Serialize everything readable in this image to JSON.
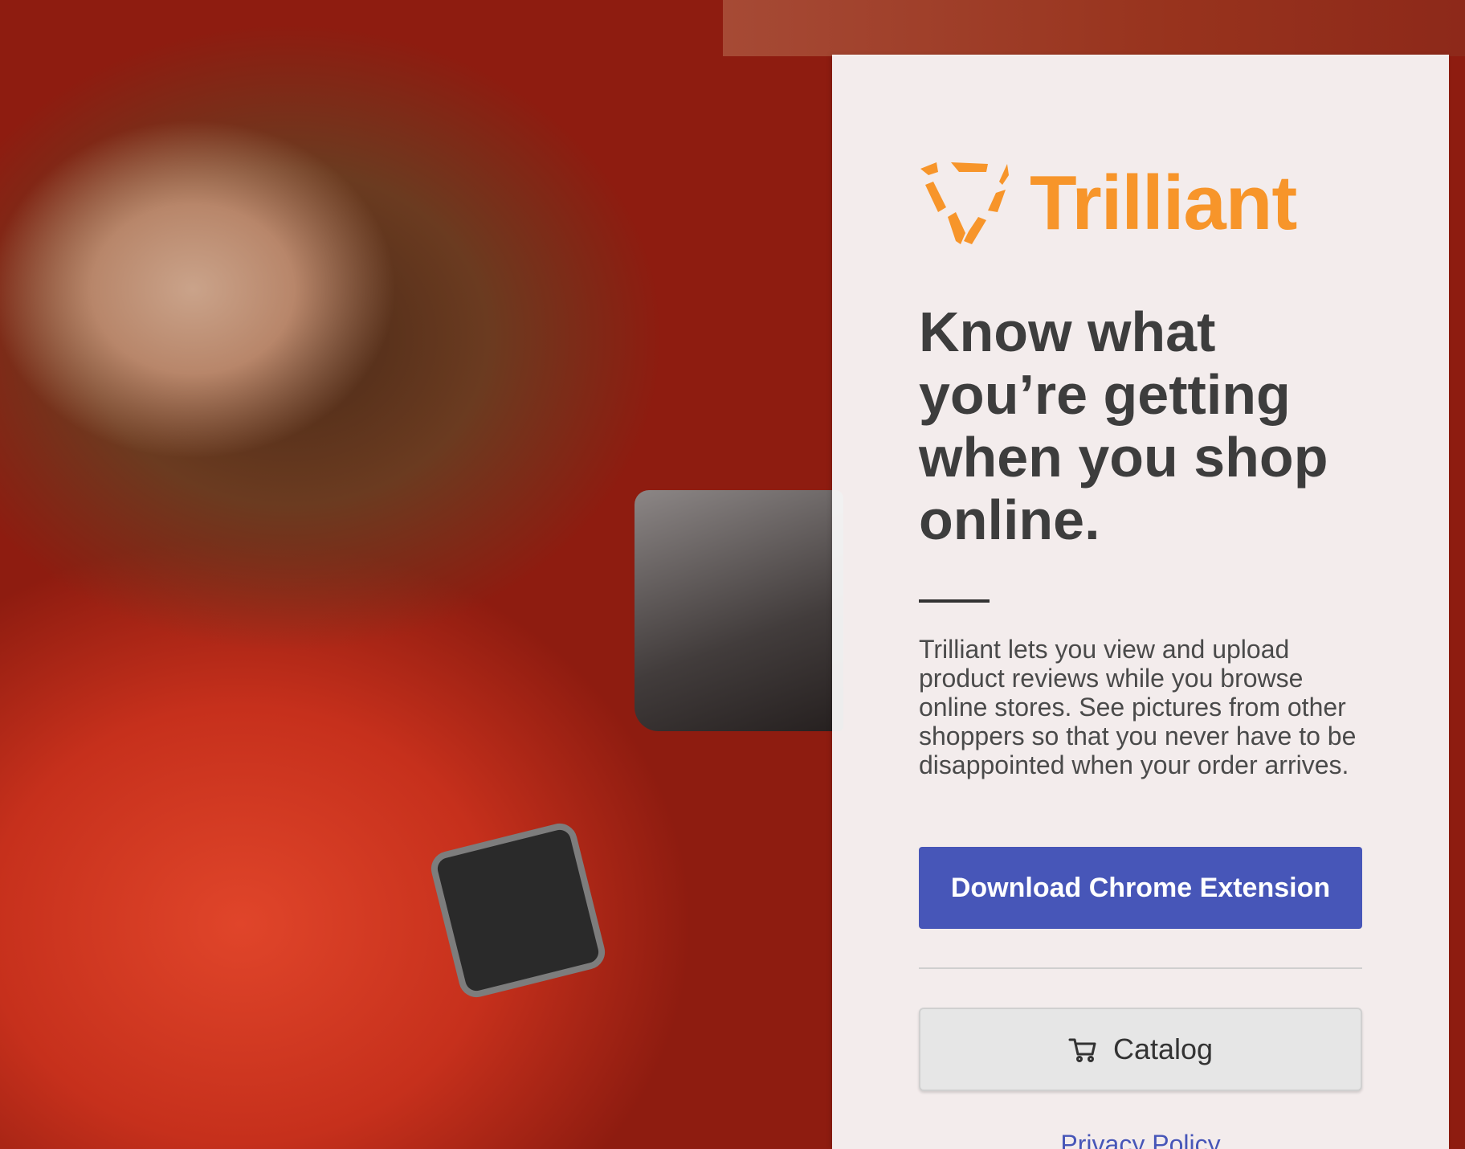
{
  "brand": {
    "name": "Trilliant",
    "color": "#f7952a",
    "logo_icon": "trilliant-triangle-logo"
  },
  "hero": {
    "headline": "Know what you’re getting when you shop online.",
    "description": "Trilliant lets you view and upload product reviews while you browse online stores. See pictures from other shoppers so that you never have to be disappointed when your order arrives."
  },
  "actions": {
    "download_label": "Download Chrome Extension",
    "download_color": "#4756b8",
    "catalog_label": "Catalog",
    "catalog_icon": "shopping-cart-icon"
  },
  "footer": {
    "privacy_label": "Privacy Policy"
  }
}
